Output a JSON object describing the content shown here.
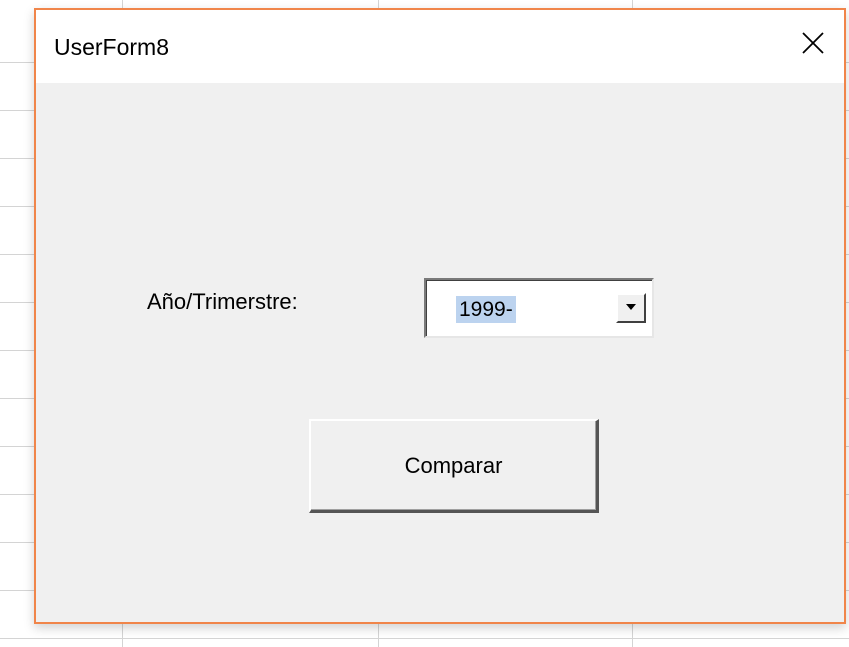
{
  "dialog": {
    "title": "UserForm8",
    "close_icon": "close-icon",
    "accent_border_color": "#f0854a"
  },
  "form": {
    "year_label": "Año/Trimerstre:",
    "year_combo": {
      "value": "1999-",
      "dropdown_icon": "chevron-down-icon"
    },
    "compare_button_label": "Comparar"
  }
}
